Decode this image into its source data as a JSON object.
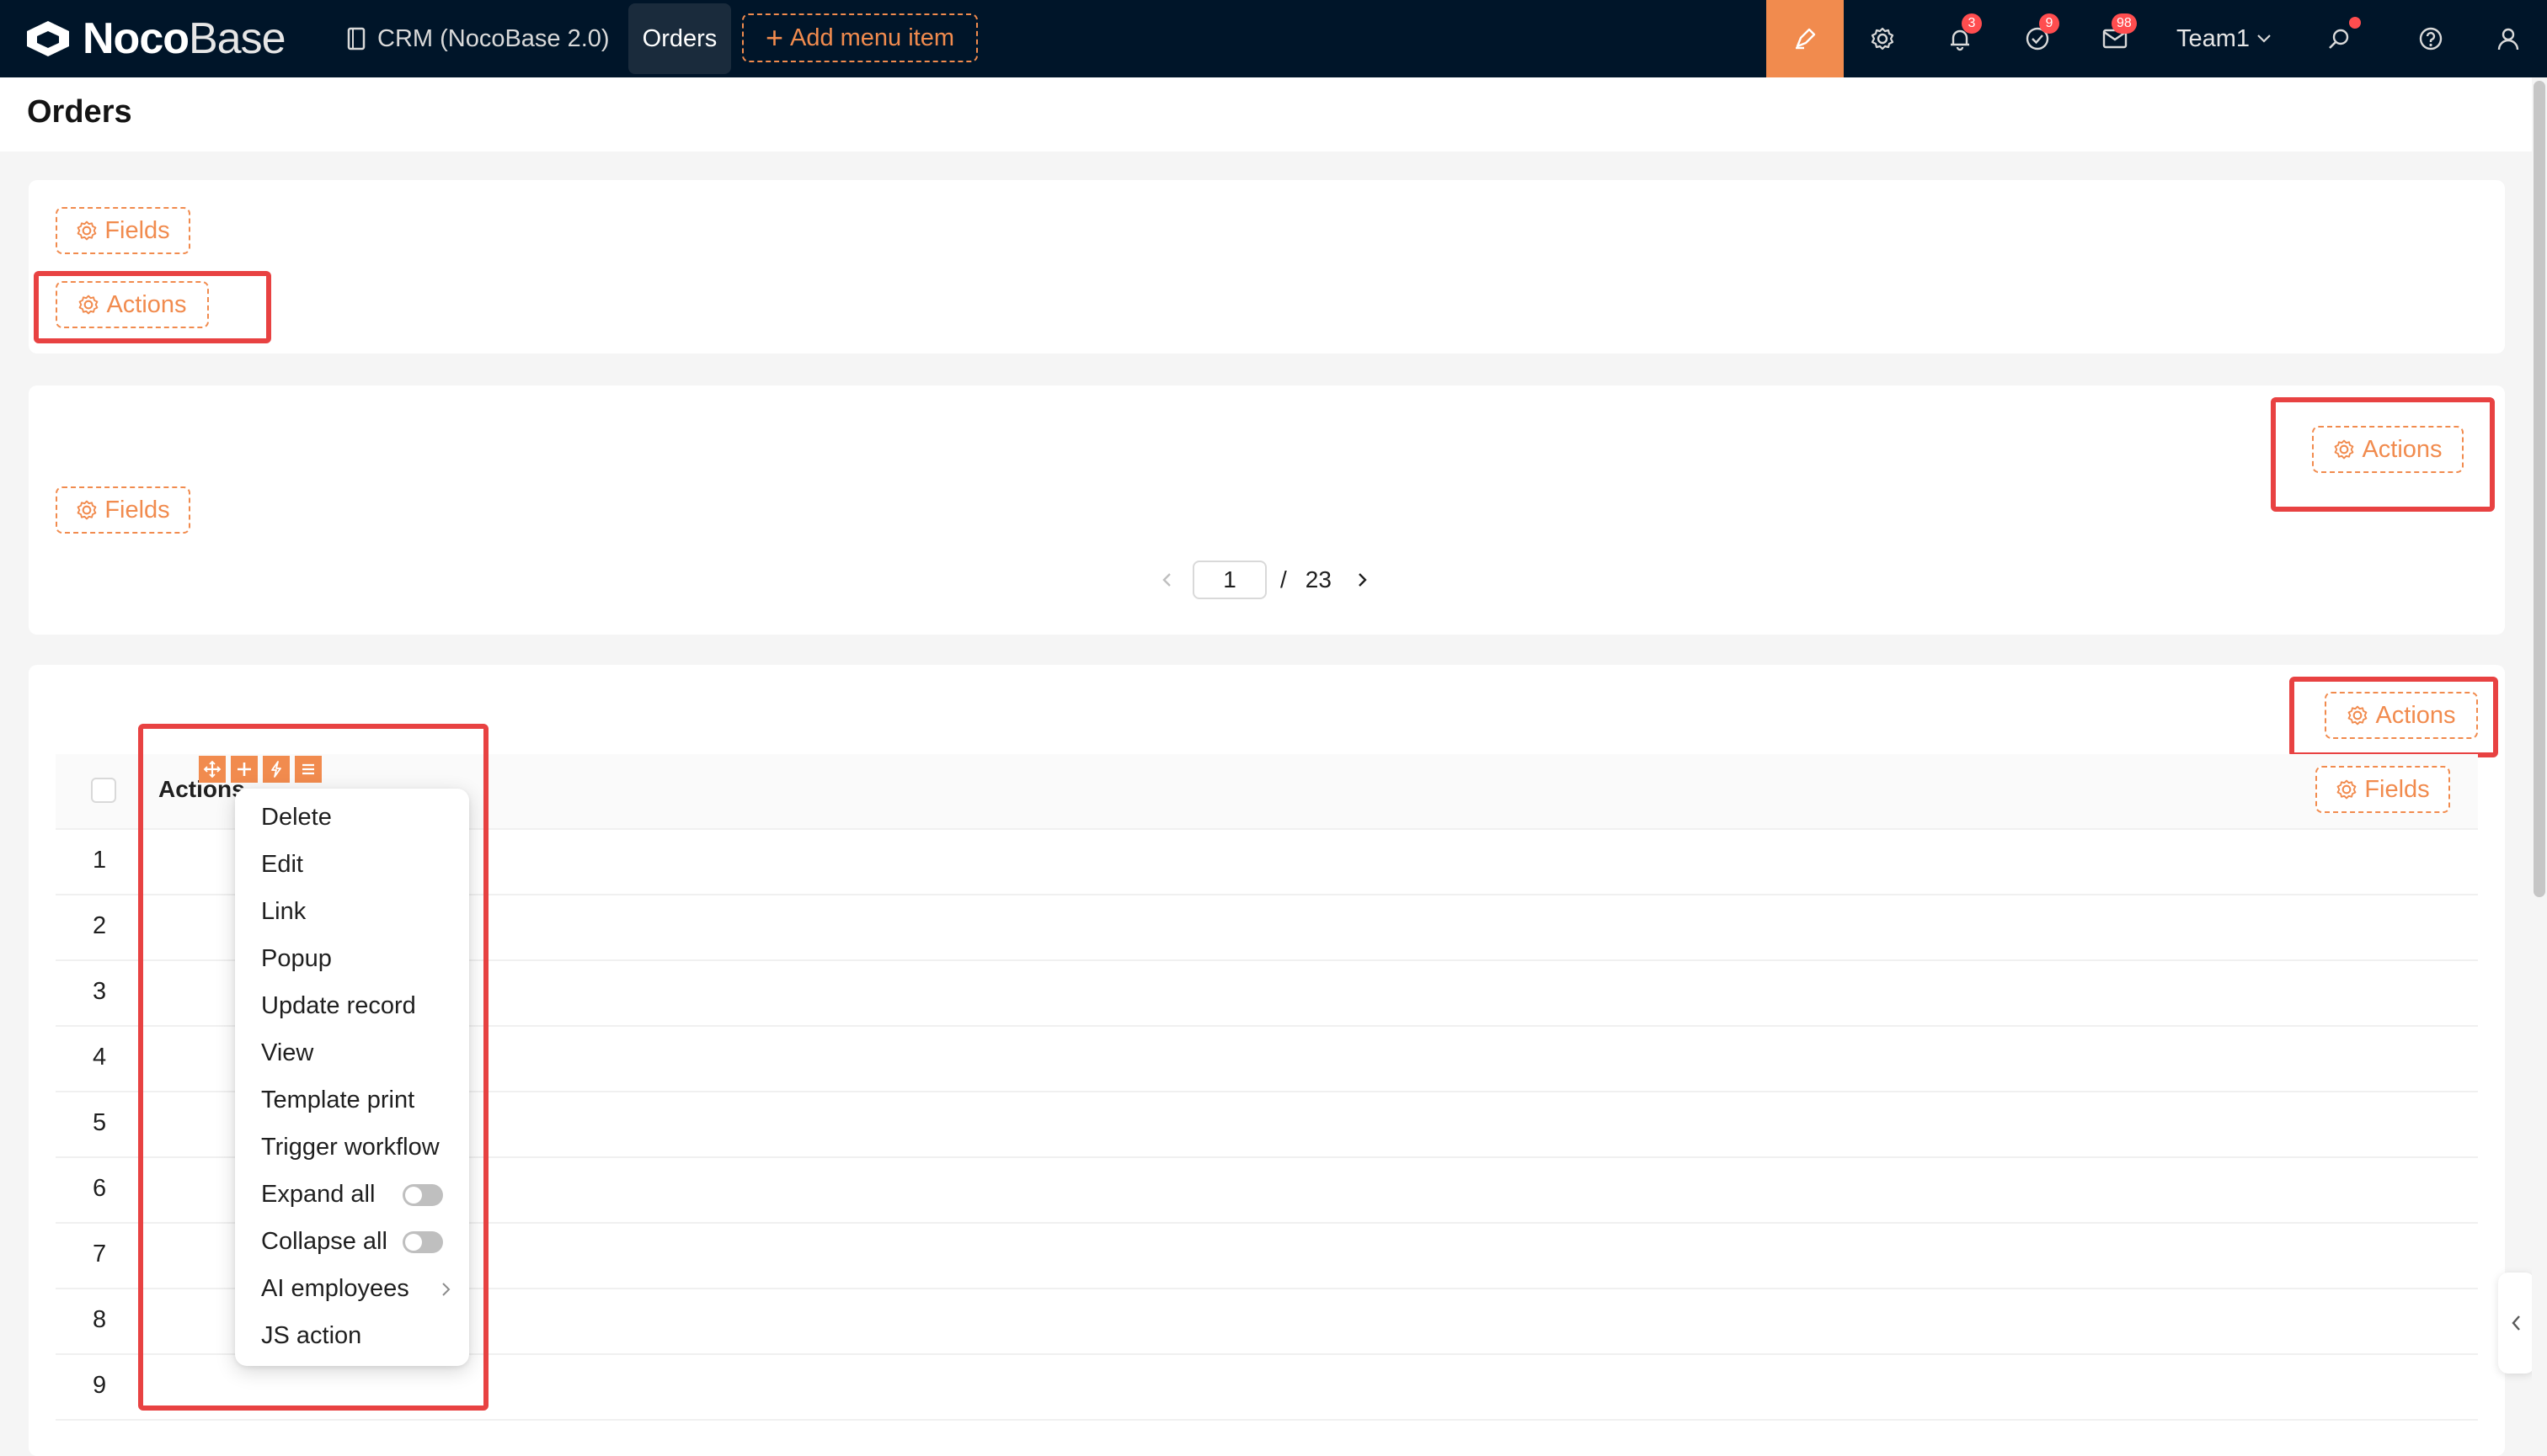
{
  "app": {
    "logo_bold": "Noco",
    "logo_light": "Base",
    "nav_crm": "CRM (NocoBase 2.0)",
    "nav_orders": "Orders",
    "add_menu_item": "Add menu item",
    "team": "Team1",
    "badges": {
      "notifications": "3",
      "tasks": "9",
      "inbox": "98"
    },
    "icons": [
      "doc-icon",
      "ui-editor-icon",
      "settings-icon",
      "bell-icon",
      "task-check-icon",
      "mail-icon",
      "search-icon",
      "help-icon",
      "user-icon"
    ]
  },
  "page": {
    "title": "Orders"
  },
  "block1": {
    "fields_label": "Fields",
    "actions_label": "Actions"
  },
  "block2": {
    "actions_label": "Actions",
    "fields_label": "Fields",
    "pagination": {
      "current": "1",
      "separator": "/",
      "total": "23"
    }
  },
  "block3": {
    "actions_label": "Actions",
    "fields_label": "Fields",
    "table": {
      "column_header": "Actions",
      "rows": [
        "1",
        "2",
        "3",
        "4",
        "5",
        "6",
        "7",
        "8",
        "9"
      ]
    }
  },
  "menu": {
    "items": [
      "Delete",
      "Edit",
      "Link",
      "Popup",
      "Update record",
      "View",
      "Template print",
      "Trigger workflow",
      "Expand all",
      "Collapse all",
      "AI employees",
      "JS action"
    ],
    "toggles": {
      "expand_all": false,
      "collapse_all": false
    }
  },
  "colors": {
    "accent": "#f18b4e",
    "topbar": "#001529",
    "highlight": "#e84242"
  }
}
